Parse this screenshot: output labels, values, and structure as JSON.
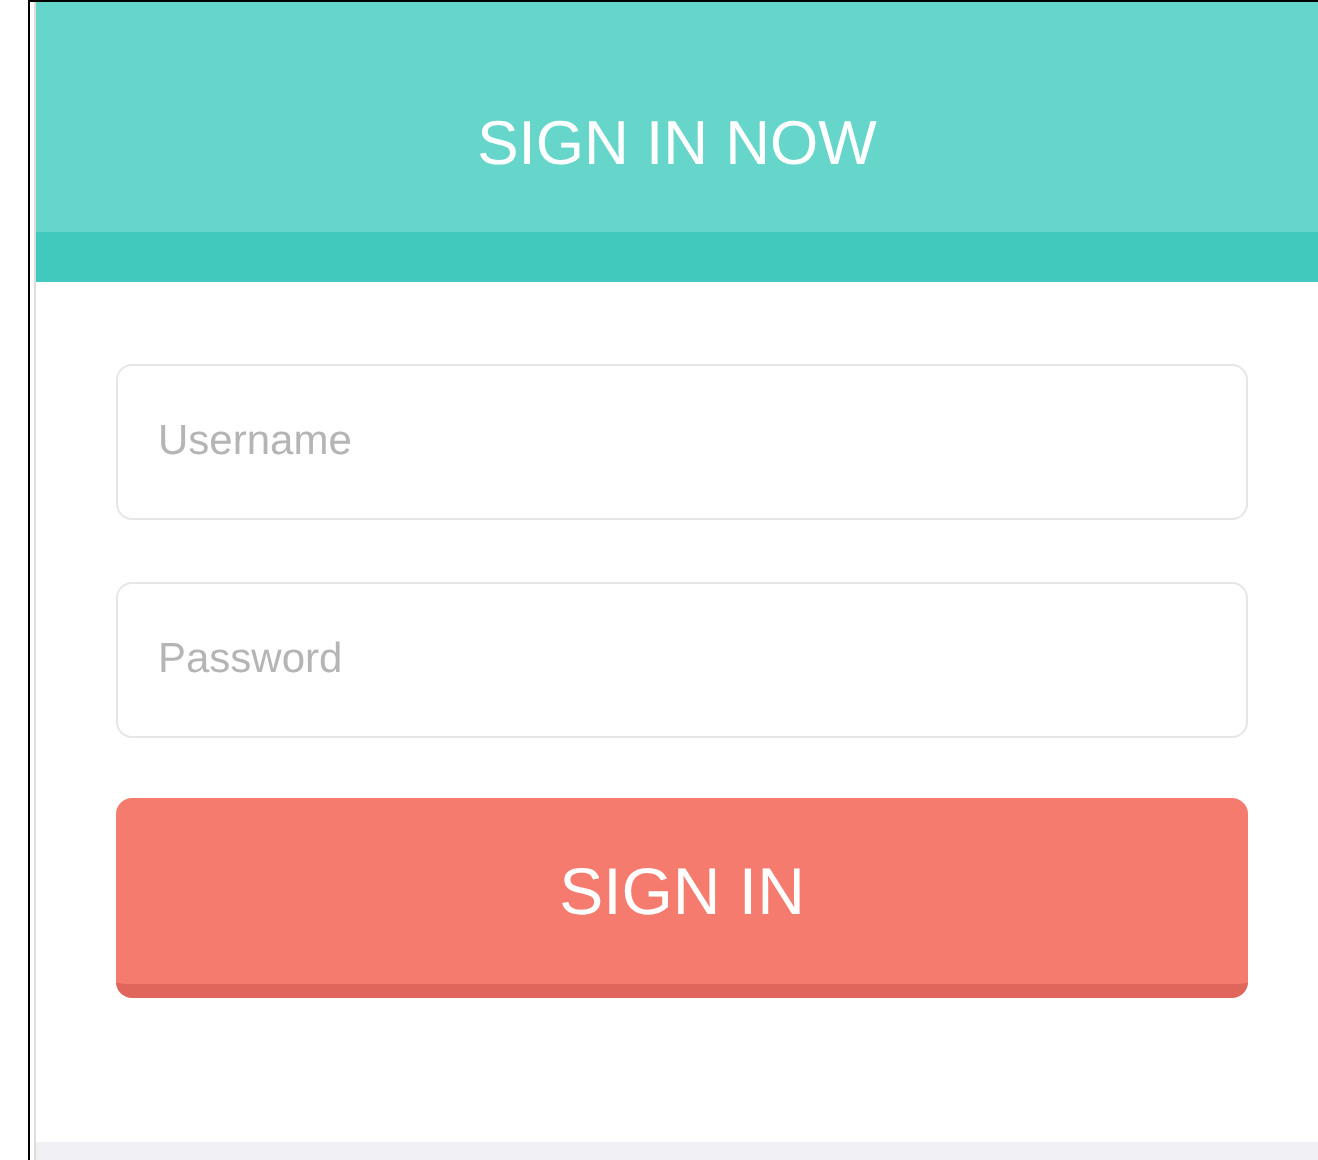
{
  "header": {
    "title": "SIGN IN NOW"
  },
  "fields": [
    {
      "placeholder": "Username"
    },
    {
      "placeholder": "Password"
    }
  ],
  "button": {
    "label": "SIGN IN"
  }
}
